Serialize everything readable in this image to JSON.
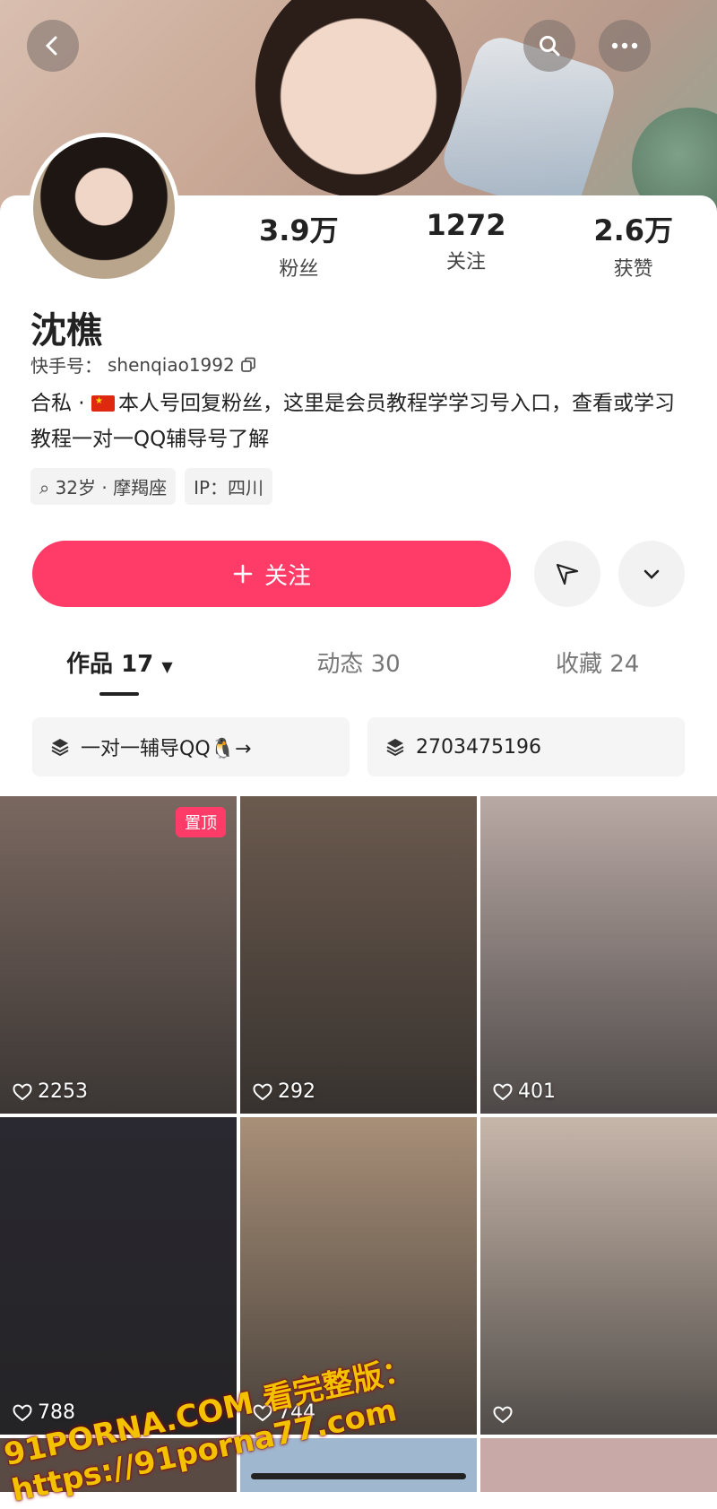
{
  "header": {
    "back_icon": "chevron-left-icon",
    "search_icon": "search-icon",
    "more_icon": "more-dots-icon"
  },
  "profile": {
    "stats": [
      {
        "value": "3.9万",
        "label": "粉丝"
      },
      {
        "value": "1272",
        "label": "关注"
      },
      {
        "value": "2.6万",
        "label": "获赞"
      }
    ],
    "name": "沈樵",
    "kuaishou_id_label": "快手号：",
    "kuaishou_id": "shenqiao1992",
    "bio_prefix": "合私 · ",
    "bio_main": "本人号回复粉丝，这里是会员教程学学习号入口，查看或学习教程一对一QQ辅导号了解",
    "tags": [
      "32岁 · 摩羯座",
      "IP：四川"
    ]
  },
  "actions": {
    "follow_label": "关注",
    "follow_icon": "plus-icon",
    "share_icon": "send-icon",
    "dropdown_icon": "chevron-down-icon"
  },
  "tabs": [
    {
      "label": "作品 17",
      "active": true
    },
    {
      "label": "动态 30",
      "active": false
    },
    {
      "label": "收藏 24",
      "active": false
    }
  ],
  "links": [
    {
      "label": "一对一辅导QQ🐧→"
    },
    {
      "label": "2703475196"
    }
  ],
  "videos": [
    {
      "likes": "2253",
      "pinned_label": "置顶",
      "bg": "#7a6860"
    },
    {
      "likes": "292",
      "bg": "#6b5a4e"
    },
    {
      "likes": "401",
      "bg": "#b9a9a4"
    },
    {
      "likes": "788",
      "bg": "#2a2830"
    },
    {
      "likes": "744",
      "bg": "#a88f78"
    },
    {
      "likes": "",
      "bg": "#c7b6aa"
    }
  ],
  "watermark": "91PORNA.COM  看完整版：https://91porna77.com",
  "colors": {
    "accent": "#fe3c67"
  }
}
